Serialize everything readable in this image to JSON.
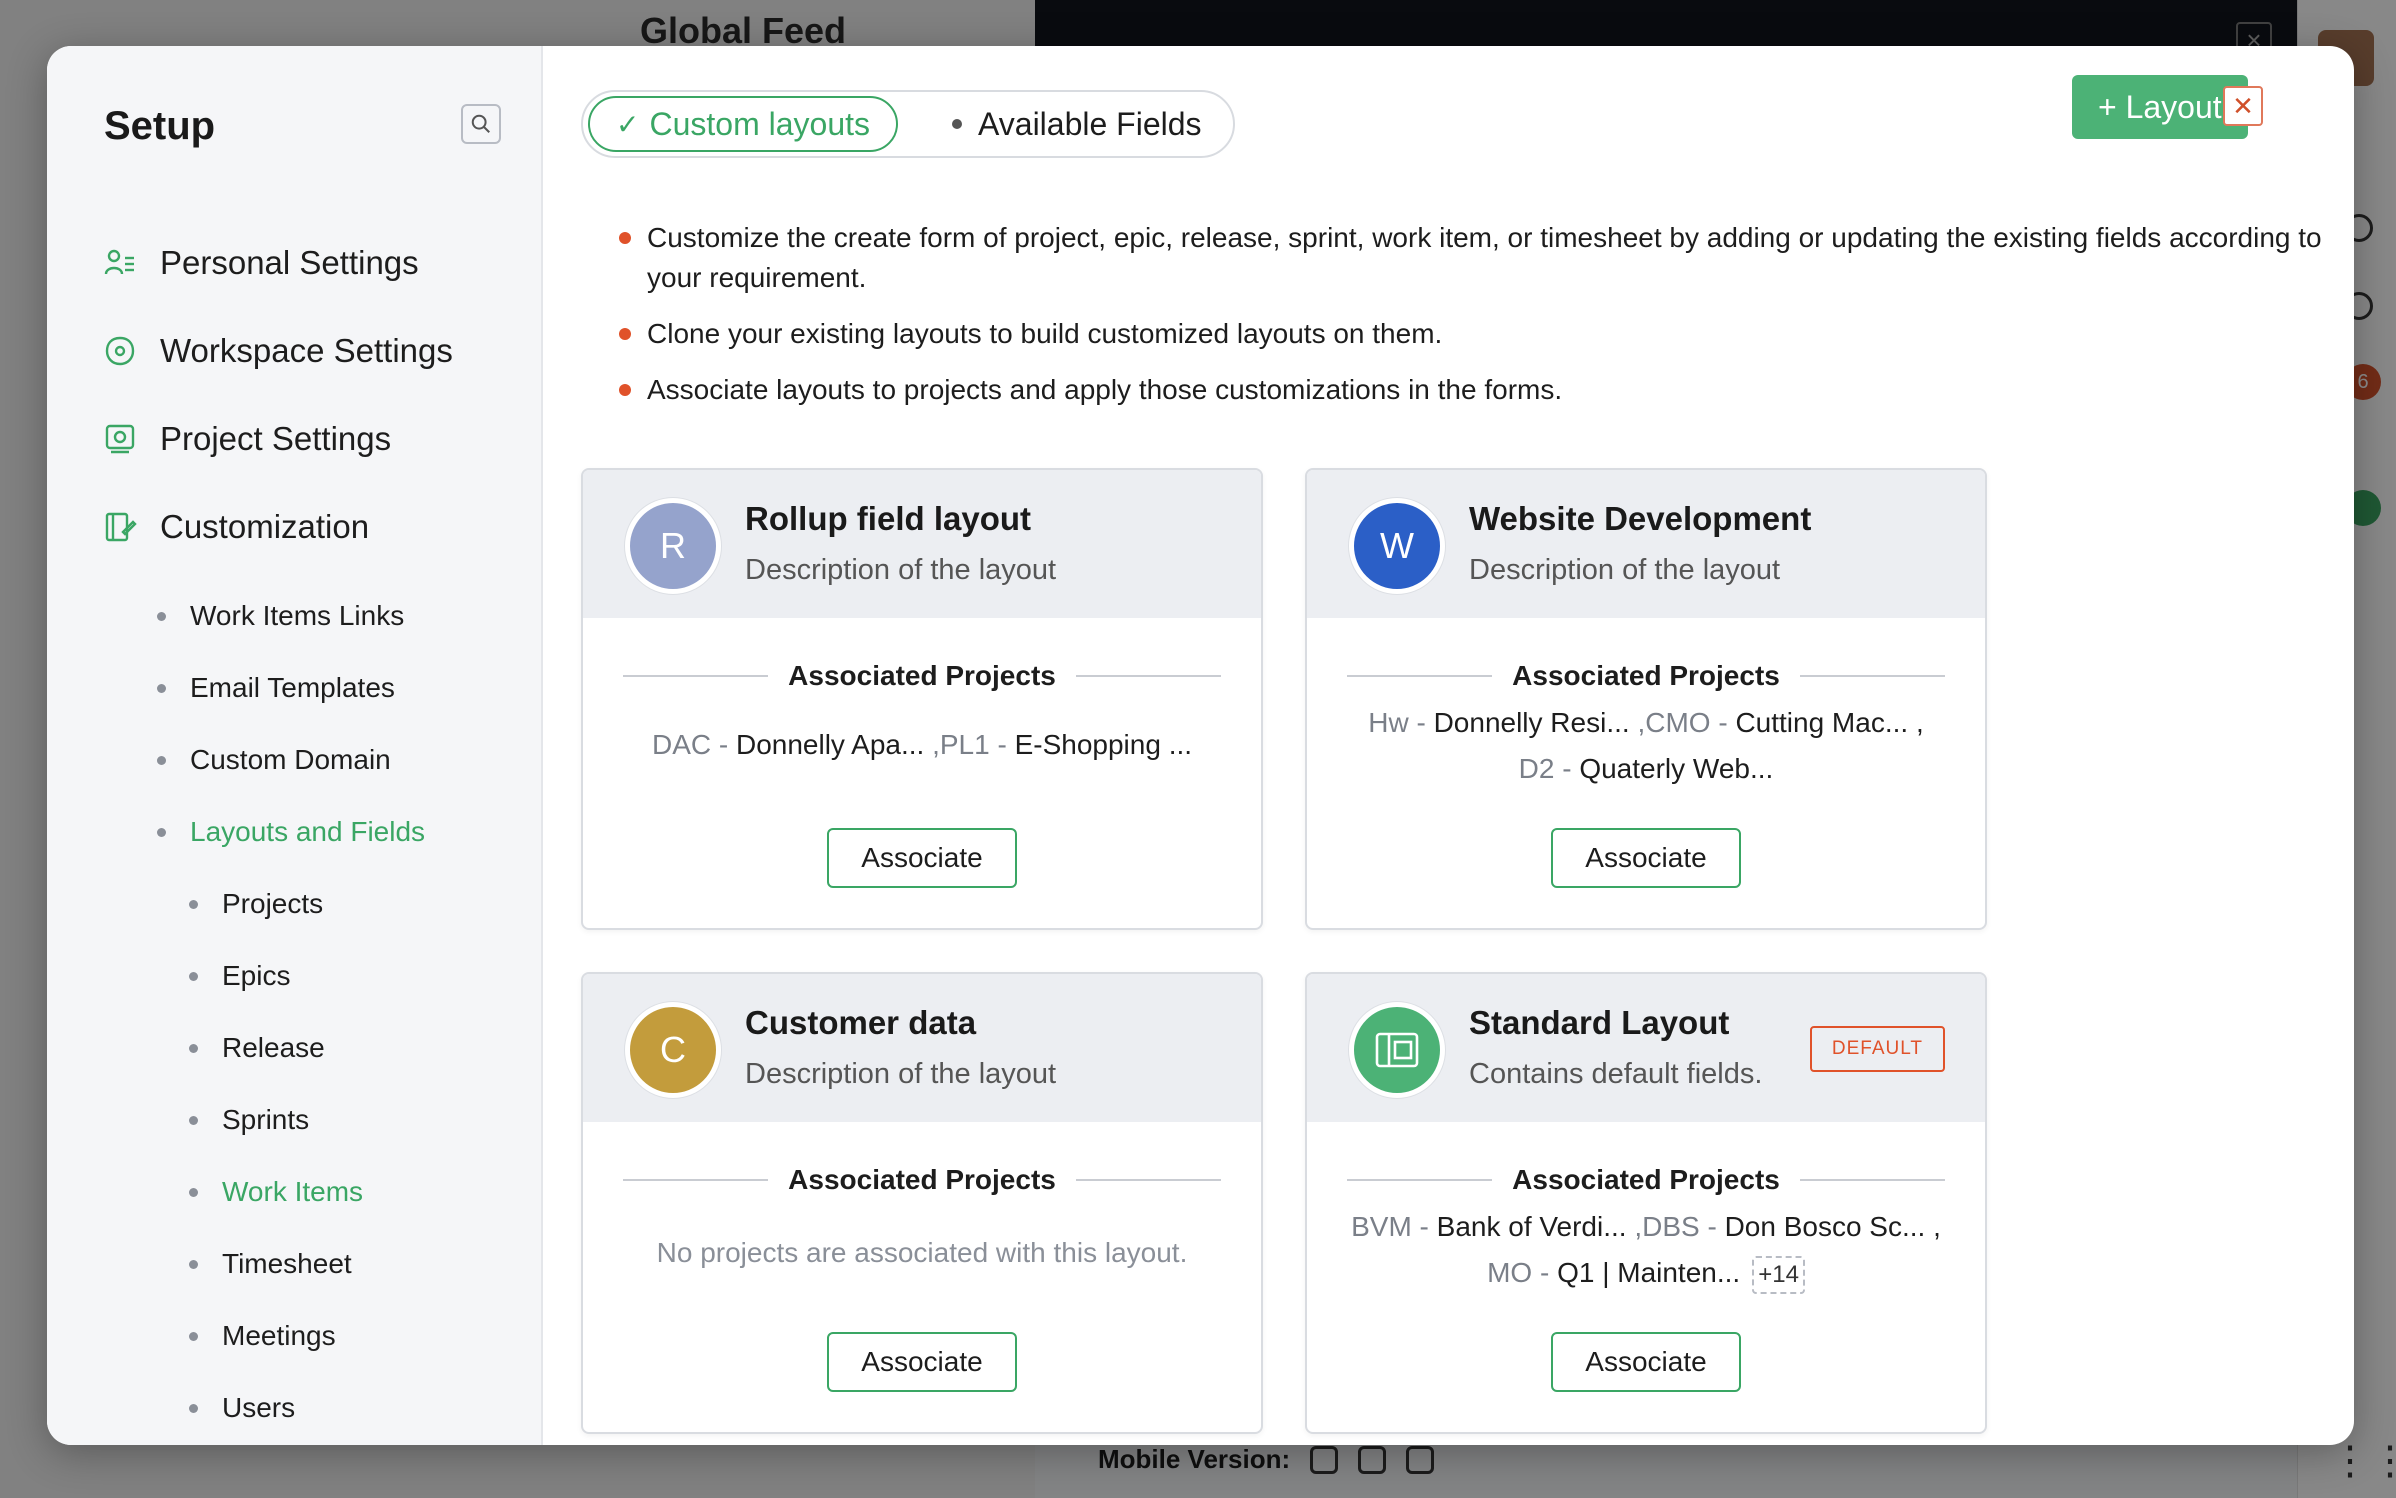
{
  "background": {
    "feed_title": "Global Feed",
    "mobile_label": "Mobile Version:",
    "badge_count": "6"
  },
  "sidebar": {
    "title": "Setup",
    "top_items": [
      {
        "label": "Personal Settings",
        "icon": "personal-settings-icon"
      },
      {
        "label": "Workspace Settings",
        "icon": "workspace-settings-icon"
      },
      {
        "label": "Project Settings",
        "icon": "project-settings-icon"
      },
      {
        "label": "Customization",
        "icon": "customization-icon"
      }
    ],
    "custom_items": [
      "Work Items Links",
      "Email Templates",
      "Custom Domain",
      "Layouts and Fields"
    ],
    "layout_items": [
      "Projects",
      "Epics",
      "Release",
      "Sprints",
      "Work Items",
      "Timesheet",
      "Meetings",
      "Users"
    ],
    "active_custom": "Layouts and Fields",
    "active_layout": "Work Items"
  },
  "tabs": {
    "active": "Custom layouts",
    "inactive": "Available Fields"
  },
  "add_layout_label": "+ Layout",
  "close_icon": "close-icon",
  "info_bullets": [
    "Customize the create form of project, epic, release, sprint, work item, or timesheet by adding or updating the existing fields according to your requirement.",
    "Clone your existing layouts to build customized layouts on them.",
    "Associate layouts to projects and apply those customizations in the forms."
  ],
  "assoc_header": "Associated Projects",
  "associate_label": "Associate",
  "cards": [
    {
      "initial": "R",
      "color": "#95a3cc",
      "title": "Rollup field layout",
      "desc": "Description of the layout",
      "line1": [
        {
          "code": "DAC - ",
          "name": "Donnelly Apa..."
        },
        {
          "code": " ,PL1 - ",
          "name": "E-Shopping ..."
        }
      ],
      "line2": []
    },
    {
      "initial": "W",
      "color": "#2b5fc7",
      "title": "Website Development",
      "desc": "Description of the layout",
      "line1": [
        {
          "code": "Hw - ",
          "name": "Donnelly Resi..."
        },
        {
          "code": " ,CMO - ",
          "name": "Cutting Mac... ,"
        }
      ],
      "line2": [
        {
          "code": "D2 - ",
          "name": "Quaterly Web..."
        }
      ]
    },
    {
      "initial": "C",
      "color": "#c39c3c",
      "title": "Customer data",
      "desc": "Description of the layout",
      "empty_text": "No projects are associated with this layout."
    },
    {
      "initial": "",
      "color": "#4cb276",
      "title": "Standard Layout",
      "desc": "Contains default fields.",
      "default_badge": "DEFAULT",
      "line1": [
        {
          "code": "BVM - ",
          "name": "Bank of Verdi..."
        },
        {
          "code": " ,DBS - ",
          "name": "Don Bosco Sc... ,"
        }
      ],
      "line2": [
        {
          "code": "MO - ",
          "name": "Q1 | Mainten..."
        }
      ],
      "more": "+14"
    }
  ]
}
